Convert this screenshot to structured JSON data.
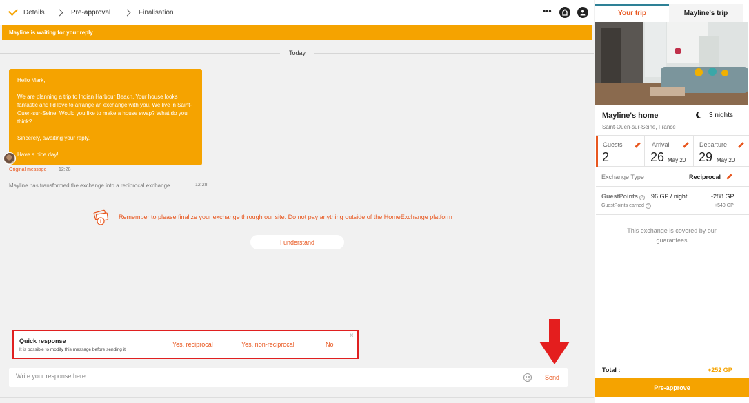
{
  "steps": {
    "details": "Details",
    "preapproval": "Pre-approval",
    "finalisation": "Finalisation"
  },
  "nav_icons": [
    "more-dots-icon",
    "home-icon",
    "profile-icon"
  ],
  "banner": "Mayline is waiting for your reply",
  "conversation": {
    "date": "Today",
    "message": "Hello Mark,\n\nWe are planning a trip to Indian Harbour Beach. Your house looks fantastic and I'd love to arrange an exchange with you. We live in Saint-Ouen-sur-Seine. Would you like to make a house swap? What do you think?\n\nSincerely, awaiting your reply.\n\nHave a nice day!",
    "original_message_label": "Original message",
    "original_message_time": "12:28",
    "system_message": "Mayline has transformed the exchange into a reciprocal exchange",
    "system_message_time": "12:28",
    "warning": "Remember to please finalize your exchange through our site. Do not pay anything outside of the HomeExchange platform",
    "understand_button": "I understand"
  },
  "quick_response": {
    "title": "Quick response",
    "subtitle": "It is possible to modify this message before sending it",
    "options": [
      "Yes, reciprocal",
      "Yes, non-reciprocal",
      "No"
    ],
    "close": "×"
  },
  "composer": {
    "placeholder": "Write your response here...",
    "send": "Send"
  },
  "panel": {
    "tabs": [
      "Your trip",
      "Mayline's trip"
    ],
    "active_tab": "Your trip",
    "home_name": "Mayline's home",
    "nights": "3 nights",
    "city": "Saint-Ouen-sur-Seine, France",
    "guests_label": "Guests",
    "guests_value": "2",
    "arrival_label": "Arrival",
    "arrival_day": "26",
    "arrival_month": "May 20",
    "departure_label": "Departure",
    "departure_day": "29",
    "departure_month": "May 20",
    "exchange_type_label": "Exchange Type",
    "exchange_type_value": "Reciprocal",
    "guestpoints_label": "GuestPoints",
    "guestpoints_rate": "96 GP / night",
    "guestpoints_value": "-288 GP",
    "guestpoints_earned_label": "GuestPoints earned",
    "guestpoints_earned_value": "+540 GP",
    "covered": "This exchange is covered by our guarantees",
    "total_label": "Total :",
    "total_value": "+252 GP",
    "preapprove_button": "Pre-approve"
  },
  "colors": {
    "brand_orange": "#f5a300",
    "accent_red": "#e8571f",
    "highlight_red": "#e02020",
    "tab_teal": "#2e8196"
  }
}
